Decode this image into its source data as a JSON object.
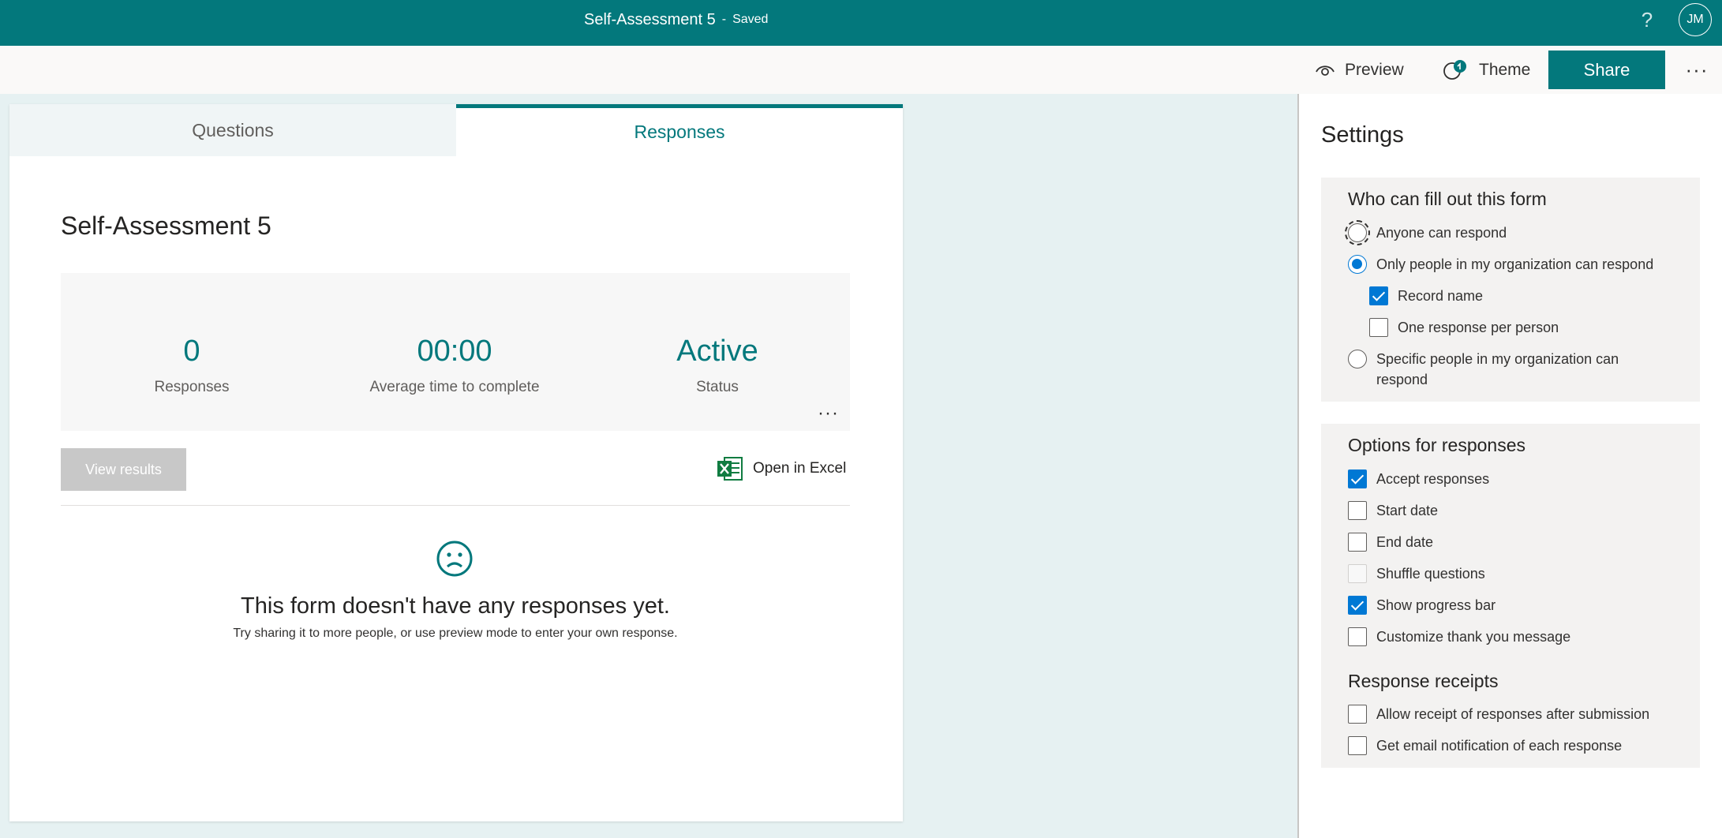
{
  "appbar": {
    "title": "Self-Assessment 5",
    "separator": "-",
    "status": "Saved",
    "help": "?",
    "avatar_initials": "JM"
  },
  "commands": {
    "preview": "Preview",
    "theme": "Theme",
    "share": "Share",
    "more": "···"
  },
  "tabs": [
    {
      "label": "Questions",
      "active": false
    },
    {
      "label": "Responses",
      "active": true
    }
  ],
  "form": {
    "title": "Self-Assessment 5",
    "stats": [
      {
        "value": "0",
        "label": "Responses"
      },
      {
        "value": "00:00",
        "label": "Average time to complete"
      },
      {
        "value": "Active",
        "label": "Status"
      }
    ],
    "stats_more": "···",
    "view_results": "View results",
    "open_excel": "Open in Excel",
    "empty_title": "This form doesn't have any responses yet.",
    "empty_subtitle": "Try sharing it to more people, or use preview mode to enter your own response."
  },
  "settings": {
    "title": "Settings",
    "who": {
      "heading": "Who can fill out this form",
      "anyone": "Anyone can respond",
      "org_only": "Only people in my organization can respond",
      "record_name": "Record name",
      "one_response": "One response per person",
      "specific_line1": "Specific people in my organization can",
      "specific_line2": "respond"
    },
    "options": {
      "heading": "Options for responses",
      "accept": "Accept responses",
      "start_date": "Start date",
      "end_date": "End date",
      "shuffle": "Shuffle questions",
      "progress_bar": "Show progress bar",
      "thank_you": "Customize thank you message"
    },
    "receipts": {
      "heading": "Response receipts",
      "allow_receipt": "Allow receipt of responses after submission",
      "email_notification": "Get email notification of each response"
    }
  },
  "colors": {
    "brand": "#03787c",
    "accent": "#0078d4",
    "background": "#e6f1f2"
  }
}
